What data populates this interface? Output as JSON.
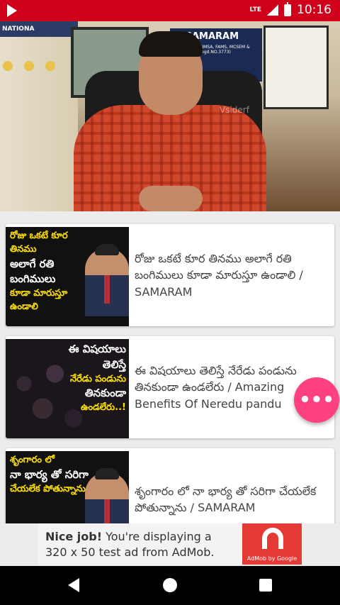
{
  "status_bar": {
    "time": "10:16",
    "network": "LTE",
    "app_icon": "play-triangle-icon"
  },
  "hero": {
    "sign_text": "NATIONA",
    "plaque_title": "G.SAMARAM",
    "plaque_sub": "B.S., PGDP, FIMSA, FAMS, MCSEM & SURGEON (Regd.NO.3773)",
    "watermark": "Vsiderf"
  },
  "videos": [
    {
      "thumb_lines": [
        "రోజు ఒకటే కూర తినము",
        "అలాగే రతి బంగిములు",
        "కూడా మారుస్తూ ఉండాలి"
      ],
      "title": "రోజు ఒకటే కూర తినము అలాగే రతి బంగిములు కూడా మారుస్తూ ఉండాలి / SAMARAM"
    },
    {
      "thumb_lines": [
        "ఈ విషయాలు తెలిస్తే",
        "నేరేడు పండును",
        "తినకుండా",
        "ఉండలేరు..!"
      ],
      "title": "ఈ విషయాలు తెలిస్తే నేరేడు పండును తినకుండా ఉండలేరు / Amazing Benefits Of Neredu pandu"
    },
    {
      "thumb_lines": [
        "శృంగారం లో",
        "నా భార్య తో సరిగా",
        "చేయలేక పోతున్నాను"
      ],
      "title": "శృంగారం లో నా భార్య తో సరిగా చేయలేక పోతున్నాను / SAMARAM"
    }
  ],
  "fab": {
    "label": "•••"
  },
  "ad": {
    "bold": "Nice job!",
    "text": " You're displaying a 320 x 50 test ad from AdMob.",
    "brand": "AdMob by Google"
  }
}
